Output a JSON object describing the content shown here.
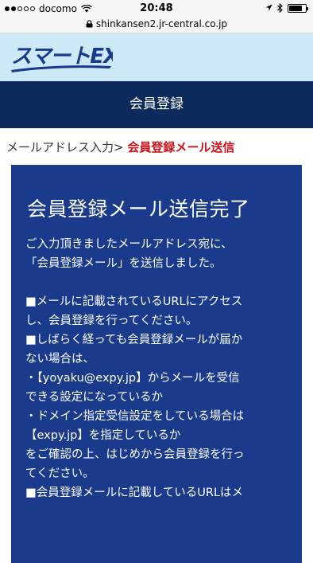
{
  "status_bar": {
    "carrier": "docomo",
    "time": "20:48"
  },
  "url_bar": {
    "url": "shinkansen2.jr-central.co.jp"
  },
  "header": {
    "logo_text": "スマートEX",
    "title": "会員登録"
  },
  "breadcrumb": {
    "step1": "メールアドレス入力",
    "separator": ">",
    "current": "会員登録メール送信"
  },
  "panel": {
    "heading": "会員登録メール送信完了",
    "lines": [
      "ご入力頂きましたメールアドレス宛に、",
      "「会員登録メール」を送信しました。",
      "",
      "■メールに記載されているURLにアクセス",
      "し、会員登録を行ってください。",
      "■しばらく経っても会員登録メールが届か",
      "ない場合は、",
      "・【yoyaku@expy.jp】からメールを受信",
      "できる設定になっているか",
      "・ドメイン指定受信設定をしている場合は",
      "【expy.jp】を指定しているか",
      "をご確認の上、はじめから会員登録を行っ",
      "てください。",
      "■会員登録メールに記載しているURLはメ"
    ]
  },
  "colors": {
    "header_bg": "#cde9f7",
    "title_bar_bg": "#0d2a5c",
    "panel_bg": "#1a3a8c",
    "breadcrumb_current": "#d0121b"
  },
  "icons": [
    "signal-dots",
    "wifi-icon",
    "lock-icon",
    "location-arrow-icon",
    "bluetooth-icon",
    "battery-icon"
  ]
}
